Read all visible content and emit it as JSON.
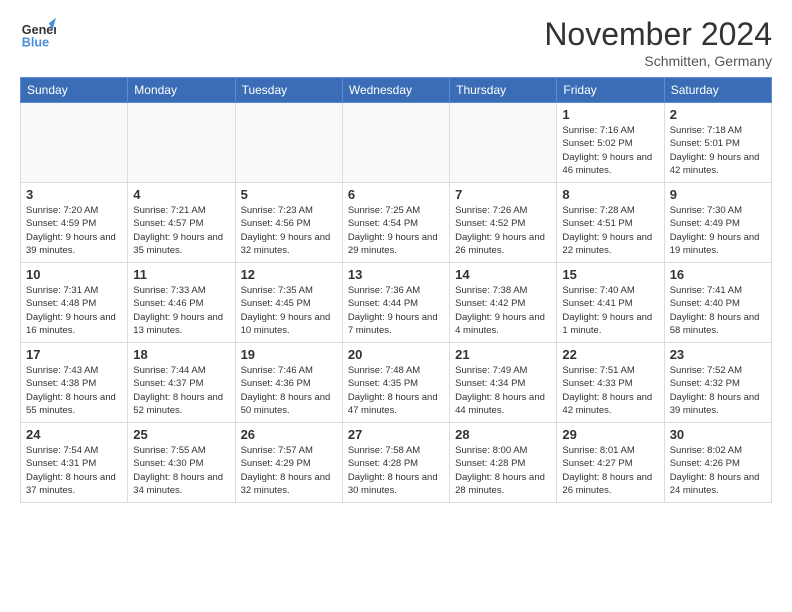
{
  "logo": {
    "general": "General",
    "blue": "Blue"
  },
  "header": {
    "month": "November 2024",
    "location": "Schmitten, Germany"
  },
  "weekdays": [
    "Sunday",
    "Monday",
    "Tuesday",
    "Wednesday",
    "Thursday",
    "Friday",
    "Saturday"
  ],
  "weeks": [
    [
      {
        "day": "",
        "info": ""
      },
      {
        "day": "",
        "info": ""
      },
      {
        "day": "",
        "info": ""
      },
      {
        "day": "",
        "info": ""
      },
      {
        "day": "",
        "info": ""
      },
      {
        "day": "1",
        "info": "Sunrise: 7:16 AM\nSunset: 5:02 PM\nDaylight: 9 hours and 46 minutes."
      },
      {
        "day": "2",
        "info": "Sunrise: 7:18 AM\nSunset: 5:01 PM\nDaylight: 9 hours and 42 minutes."
      }
    ],
    [
      {
        "day": "3",
        "info": "Sunrise: 7:20 AM\nSunset: 4:59 PM\nDaylight: 9 hours and 39 minutes."
      },
      {
        "day": "4",
        "info": "Sunrise: 7:21 AM\nSunset: 4:57 PM\nDaylight: 9 hours and 35 minutes."
      },
      {
        "day": "5",
        "info": "Sunrise: 7:23 AM\nSunset: 4:56 PM\nDaylight: 9 hours and 32 minutes."
      },
      {
        "day": "6",
        "info": "Sunrise: 7:25 AM\nSunset: 4:54 PM\nDaylight: 9 hours and 29 minutes."
      },
      {
        "day": "7",
        "info": "Sunrise: 7:26 AM\nSunset: 4:52 PM\nDaylight: 9 hours and 26 minutes."
      },
      {
        "day": "8",
        "info": "Sunrise: 7:28 AM\nSunset: 4:51 PM\nDaylight: 9 hours and 22 minutes."
      },
      {
        "day": "9",
        "info": "Sunrise: 7:30 AM\nSunset: 4:49 PM\nDaylight: 9 hours and 19 minutes."
      }
    ],
    [
      {
        "day": "10",
        "info": "Sunrise: 7:31 AM\nSunset: 4:48 PM\nDaylight: 9 hours and 16 minutes."
      },
      {
        "day": "11",
        "info": "Sunrise: 7:33 AM\nSunset: 4:46 PM\nDaylight: 9 hours and 13 minutes."
      },
      {
        "day": "12",
        "info": "Sunrise: 7:35 AM\nSunset: 4:45 PM\nDaylight: 9 hours and 10 minutes."
      },
      {
        "day": "13",
        "info": "Sunrise: 7:36 AM\nSunset: 4:44 PM\nDaylight: 9 hours and 7 minutes."
      },
      {
        "day": "14",
        "info": "Sunrise: 7:38 AM\nSunset: 4:42 PM\nDaylight: 9 hours and 4 minutes."
      },
      {
        "day": "15",
        "info": "Sunrise: 7:40 AM\nSunset: 4:41 PM\nDaylight: 9 hours and 1 minute."
      },
      {
        "day": "16",
        "info": "Sunrise: 7:41 AM\nSunset: 4:40 PM\nDaylight: 8 hours and 58 minutes."
      }
    ],
    [
      {
        "day": "17",
        "info": "Sunrise: 7:43 AM\nSunset: 4:38 PM\nDaylight: 8 hours and 55 minutes."
      },
      {
        "day": "18",
        "info": "Sunrise: 7:44 AM\nSunset: 4:37 PM\nDaylight: 8 hours and 52 minutes."
      },
      {
        "day": "19",
        "info": "Sunrise: 7:46 AM\nSunset: 4:36 PM\nDaylight: 8 hours and 50 minutes."
      },
      {
        "day": "20",
        "info": "Sunrise: 7:48 AM\nSunset: 4:35 PM\nDaylight: 8 hours and 47 minutes."
      },
      {
        "day": "21",
        "info": "Sunrise: 7:49 AM\nSunset: 4:34 PM\nDaylight: 8 hours and 44 minutes."
      },
      {
        "day": "22",
        "info": "Sunrise: 7:51 AM\nSunset: 4:33 PM\nDaylight: 8 hours and 42 minutes."
      },
      {
        "day": "23",
        "info": "Sunrise: 7:52 AM\nSunset: 4:32 PM\nDaylight: 8 hours and 39 minutes."
      }
    ],
    [
      {
        "day": "24",
        "info": "Sunrise: 7:54 AM\nSunset: 4:31 PM\nDaylight: 8 hours and 37 minutes."
      },
      {
        "day": "25",
        "info": "Sunrise: 7:55 AM\nSunset: 4:30 PM\nDaylight: 8 hours and 34 minutes."
      },
      {
        "day": "26",
        "info": "Sunrise: 7:57 AM\nSunset: 4:29 PM\nDaylight: 8 hours and 32 minutes."
      },
      {
        "day": "27",
        "info": "Sunrise: 7:58 AM\nSunset: 4:28 PM\nDaylight: 8 hours and 30 minutes."
      },
      {
        "day": "28",
        "info": "Sunrise: 8:00 AM\nSunset: 4:28 PM\nDaylight: 8 hours and 28 minutes."
      },
      {
        "day": "29",
        "info": "Sunrise: 8:01 AM\nSunset: 4:27 PM\nDaylight: 8 hours and 26 minutes."
      },
      {
        "day": "30",
        "info": "Sunrise: 8:02 AM\nSunset: 4:26 PM\nDaylight: 8 hours and 24 minutes."
      }
    ]
  ]
}
